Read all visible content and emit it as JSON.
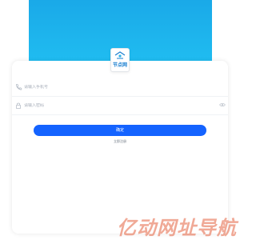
{
  "logo": {
    "text": "节点网",
    "icon": "logo-icon"
  },
  "login": {
    "phone_placeholder": "请输入手机号",
    "phone_icon": "phone-icon",
    "password_placeholder": "请输入密码",
    "password_icon": "lock-icon",
    "visibility_icon": "eye-icon",
    "submit_label": "确定",
    "register_link": "立即注册"
  },
  "watermark": {
    "text": "亿动网址导航"
  },
  "colors": {
    "hero_top": "#1aa9e8",
    "hero_bottom": "#21c0f2",
    "button": "#1463ff",
    "watermark": "#e4623f"
  }
}
